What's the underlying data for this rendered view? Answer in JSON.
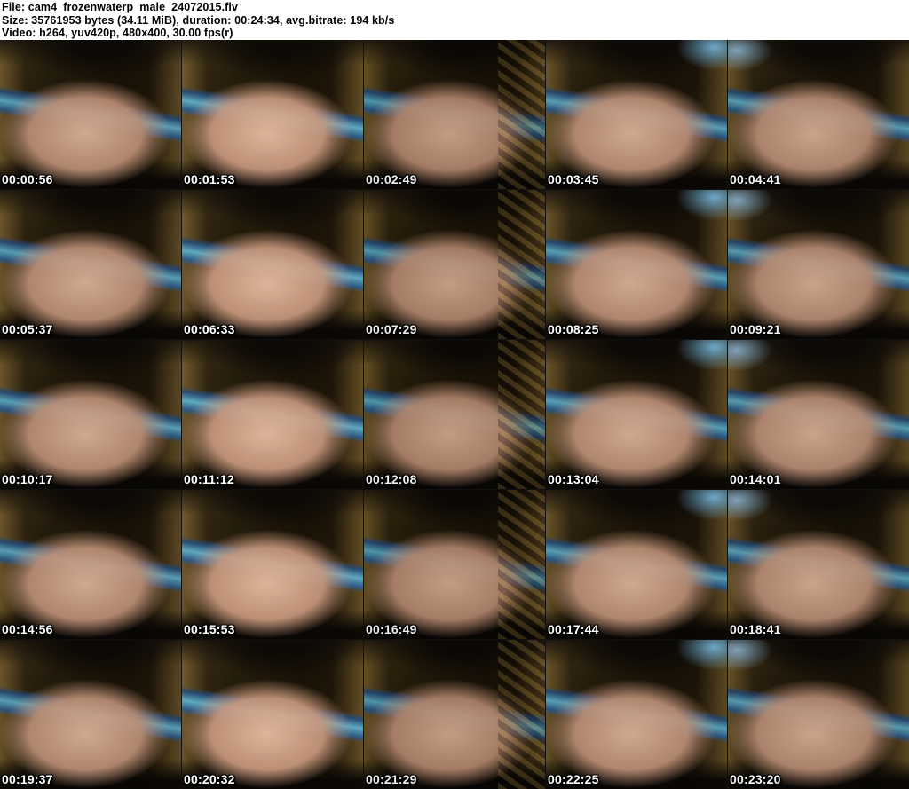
{
  "header": {
    "lines": [
      "File: cam4_frozenwaterp_male_24072015.flv",
      "Size: 35761953 bytes (34.11 MiB), duration: 00:24:34, avg.bitrate: 194 kb/s",
      "Video: h264, yuv420p, 480x400, 30.00 fps(r)"
    ],
    "file_name": "cam4_frozenwaterp_male_24072015.flv",
    "size_bytes": "35761953",
    "size_readable": "34.11 MiB",
    "duration": "00:24:34",
    "avg_bitrate": "194 kb/s",
    "video_codec": "h264",
    "pixel_format": "yuv420p",
    "resolution": "480x400",
    "frame_rate": "30.00 fps(r)"
  },
  "thumbnails": {
    "columns": 5,
    "rows": 5,
    "timestamps": [
      "00:00:56",
      "00:01:53",
      "00:02:49",
      "00:03:45",
      "00:04:41",
      "00:05:37",
      "00:06:33",
      "00:07:29",
      "00:08:25",
      "00:09:21",
      "00:10:17",
      "00:11:12",
      "00:12:08",
      "00:13:04",
      "00:14:01",
      "00:14:56",
      "00:15:53",
      "00:16:49",
      "00:17:44",
      "00:18:41",
      "00:19:37",
      "00:20:32",
      "00:21:29",
      "00:22:25",
      "00:23:20"
    ]
  },
  "colors": {
    "header_bg": "#ffffff",
    "header_text": "#000000",
    "timestamp_text": "#ffffff",
    "timestamp_outline": "#000000",
    "grid_gap": "#101010"
  }
}
